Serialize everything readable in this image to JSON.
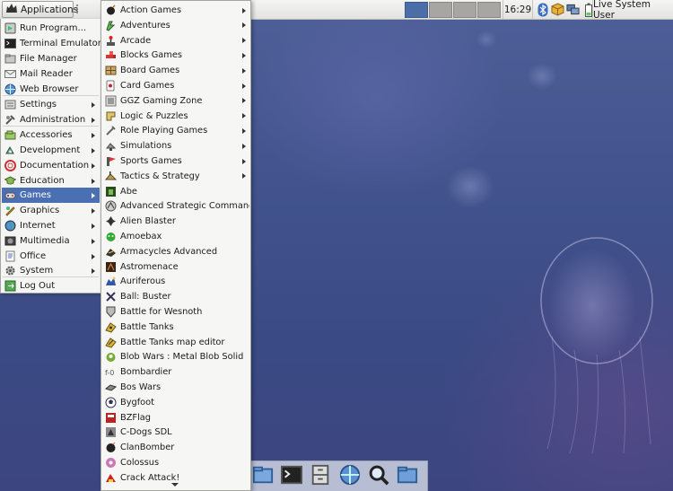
{
  "top_panel": {
    "applications_label": "Applications",
    "clock": "16:29",
    "user": "Live System User",
    "workspaces": [
      {
        "active": true
      },
      {
        "active": false
      },
      {
        "active": false
      },
      {
        "active": false
      }
    ],
    "tray_icons": [
      "bluetooth-icon",
      "package-updates-icon",
      "network-icon",
      "battery-icon"
    ]
  },
  "main_menu": {
    "items": [
      {
        "label": "Run Program...",
        "icon": "run-icon",
        "submenu": false
      },
      {
        "label": "Terminal Emulator",
        "icon": "terminal-icon",
        "submenu": false
      },
      {
        "label": "File Manager",
        "icon": "file-manager-icon",
        "submenu": false
      },
      {
        "label": "Mail Reader",
        "icon": "mail-icon",
        "submenu": false
      },
      {
        "label": "Web Browser",
        "icon": "web-browser-icon",
        "submenu": false
      },
      {
        "label": "Settings",
        "icon": "settings-icon",
        "submenu": true
      },
      {
        "label": "Administration",
        "icon": "administration-icon",
        "submenu": true
      },
      {
        "label": "Accessories",
        "icon": "accessories-icon",
        "submenu": true
      },
      {
        "label": "Development",
        "icon": "development-icon",
        "submenu": true
      },
      {
        "label": "Documentation",
        "icon": "documentation-icon",
        "submenu": true
      },
      {
        "label": "Education",
        "icon": "education-icon",
        "submenu": true
      },
      {
        "label": "Games",
        "icon": "games-icon",
        "submenu": true,
        "active": true
      },
      {
        "label": "Graphics",
        "icon": "graphics-icon",
        "submenu": true
      },
      {
        "label": "Internet",
        "icon": "internet-icon",
        "submenu": true
      },
      {
        "label": "Multimedia",
        "icon": "multimedia-icon",
        "submenu": true
      },
      {
        "label": "Office",
        "icon": "office-icon",
        "submenu": true
      },
      {
        "label": "System",
        "icon": "system-icon",
        "submenu": true
      },
      {
        "label": "Log Out",
        "icon": "log-out-icon",
        "submenu": false
      }
    ]
  },
  "games_menu": {
    "items": [
      {
        "label": "Action Games",
        "icon": "action-games-icon",
        "submenu": true
      },
      {
        "label": "Adventures",
        "icon": "adventures-icon",
        "submenu": true
      },
      {
        "label": "Arcade",
        "icon": "arcade-icon",
        "submenu": true
      },
      {
        "label": "Blocks Games",
        "icon": "blocks-games-icon",
        "submenu": true
      },
      {
        "label": "Board Games",
        "icon": "board-games-icon",
        "submenu": true
      },
      {
        "label": "Card Games",
        "icon": "card-games-icon",
        "submenu": true
      },
      {
        "label": "GGZ Gaming Zone",
        "icon": "ggz-icon",
        "submenu": true
      },
      {
        "label": "Logic & Puzzles",
        "icon": "logic-puzzles-icon",
        "submenu": true
      },
      {
        "label": "Role Playing Games",
        "icon": "role-playing-icon",
        "submenu": true
      },
      {
        "label": "Simulations",
        "icon": "simulations-icon",
        "submenu": true
      },
      {
        "label": "Sports Games",
        "icon": "sports-games-icon",
        "submenu": true
      },
      {
        "label": "Tactics & Strategy",
        "icon": "tactics-strategy-icon",
        "submenu": true
      },
      {
        "label": "Abe",
        "icon": "abe-icon",
        "submenu": false
      },
      {
        "label": "Advanced Strategic Command",
        "icon": "asc-icon",
        "submenu": false
      },
      {
        "label": "Alien Blaster",
        "icon": "alien-blaster-icon",
        "submenu": false
      },
      {
        "label": "Amoebax",
        "icon": "amoebax-icon",
        "submenu": false
      },
      {
        "label": "Armacycles Advanced",
        "icon": "armacycles-icon",
        "submenu": false
      },
      {
        "label": "Astromenace",
        "icon": "astromenace-icon",
        "submenu": false
      },
      {
        "label": "Auriferous",
        "icon": "auriferous-icon",
        "submenu": false
      },
      {
        "label": "Ball: Buster",
        "icon": "ball-buster-icon",
        "submenu": false
      },
      {
        "label": "Battle for Wesnoth",
        "icon": "wesnoth-icon",
        "submenu": false
      },
      {
        "label": "Battle Tanks",
        "icon": "battle-tanks-icon",
        "submenu": false
      },
      {
        "label": "Battle Tanks map editor",
        "icon": "battle-tanks-editor-icon",
        "submenu": false
      },
      {
        "label": "Blob Wars : Metal Blob Solid",
        "icon": "blob-wars-icon",
        "submenu": false
      },
      {
        "label": "Bombardier",
        "icon": "bombardier-icon",
        "submenu": false
      },
      {
        "label": "Bos Wars",
        "icon": "bos-wars-icon",
        "submenu": false
      },
      {
        "label": "Bygfoot",
        "icon": "bygfoot-icon",
        "submenu": false
      },
      {
        "label": "BZFlag",
        "icon": "bzflag-icon",
        "submenu": false
      },
      {
        "label": "C-Dogs SDL",
        "icon": "c-dogs-icon",
        "submenu": false
      },
      {
        "label": "ClanBomber",
        "icon": "clanbomber-icon",
        "submenu": false
      },
      {
        "label": "Colossus",
        "icon": "colossus-icon",
        "submenu": false
      },
      {
        "label": "Crack Attack!",
        "icon": "crack-attack-icon",
        "submenu": false
      }
    ]
  },
  "dock": {
    "icons": [
      "home-folder-icon",
      "terminal-icon",
      "file-cabinet-icon",
      "web-browser-icon",
      "search-icon",
      "folder-icon"
    ]
  },
  "colors": {
    "selection": "#4a6fb3",
    "desktop": "#41528c",
    "active_workspace": "#4c6ea8"
  }
}
